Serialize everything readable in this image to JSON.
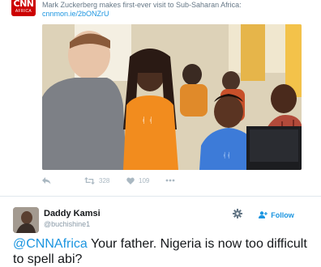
{
  "parent_tweet": {
    "logo": {
      "line1": "CNN",
      "line2": "AFRICA",
      "color": "#cc0000"
    },
    "text": "Mark Zuckerberg makes first-ever visit to Sub-Saharan Africa:",
    "link": "cnnmon.ie/2bONZrU",
    "actions": {
      "reply_icon": "reply-arrow-icon",
      "retweet_icon": "retweet-icon",
      "retweet_count": "328",
      "like_icon": "heart-icon",
      "like_count": "109",
      "more_icon": "more-dots-icon"
    }
  },
  "reply_tweet": {
    "display_name": "Daddy Kamsi",
    "handle": "@buchishine1",
    "settings_icon": "gear-icon",
    "follow_label": "Follow",
    "follow_icon": "add-user-icon",
    "mention": "@CNNAfrica",
    "text": " Your father. Nigeria is now too difficult to spell abi?"
  },
  "colors": {
    "link_blue": "#1b95e0",
    "muted_gray": "#657786",
    "icon_gray": "#aab8c2",
    "text": "#14171a"
  }
}
